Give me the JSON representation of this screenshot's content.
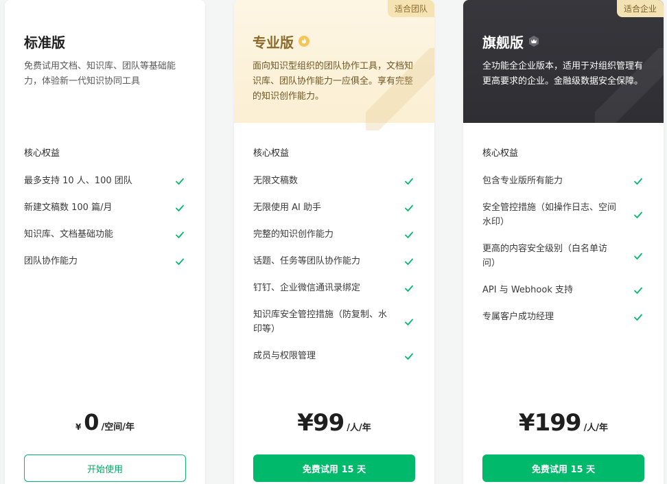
{
  "plans": [
    {
      "name": "标准版",
      "description": "免费试用文档、知识库、团队等基础能力，体验新一代知识协同工具",
      "section_label": "核心权益",
      "features": [
        "最多支持 10 人、100 团队",
        "新建文稿数 100 篇/月",
        "知识库、文档基础功能",
        "团队协作能力"
      ],
      "price_currency": "¥",
      "price": "0",
      "price_unit": "/空间/年",
      "button_label": "开始使用"
    },
    {
      "name": "专业版",
      "ribbon": "适合团队",
      "description": "面向知识型组织的团队协作工具，文档知识库、团队协作能力一应俱全。享有完整的知识创作能力。",
      "section_label": "核心权益",
      "features": [
        "无限文稿数",
        "无限使用 AI 助手",
        "完整的知识创作能力",
        "话题、任务等团队协作能力",
        "钉钉、企业微信通讯录绑定",
        "知识库安全管控措施（防复制、水印等）",
        "成员与权限管理"
      ],
      "price": "¥99",
      "price_unit": "/人/年",
      "button_label": "免费试用 15 天"
    },
    {
      "name": "旗舰版",
      "ribbon": "适合企业",
      "description": "全功能全企业版本，适用于对组织管理有更高要求的企业。金融级数据安全保障。",
      "section_label": "核心权益",
      "features": [
        "包含专业版所有能力",
        "安全管控措施（如操作日志、空间水印）",
        "更高的内容安全级别（白名单访问）",
        "API 与 Webhook 支持",
        "专属客户成功经理"
      ],
      "price": "¥199",
      "price_unit": "/人/年",
      "button_label": "免费试用 15 天"
    }
  ],
  "colors": {
    "accent_green": "#00b96b",
    "pro_gold": "#8b6a2b",
    "flagship_dark": "#37373c"
  }
}
